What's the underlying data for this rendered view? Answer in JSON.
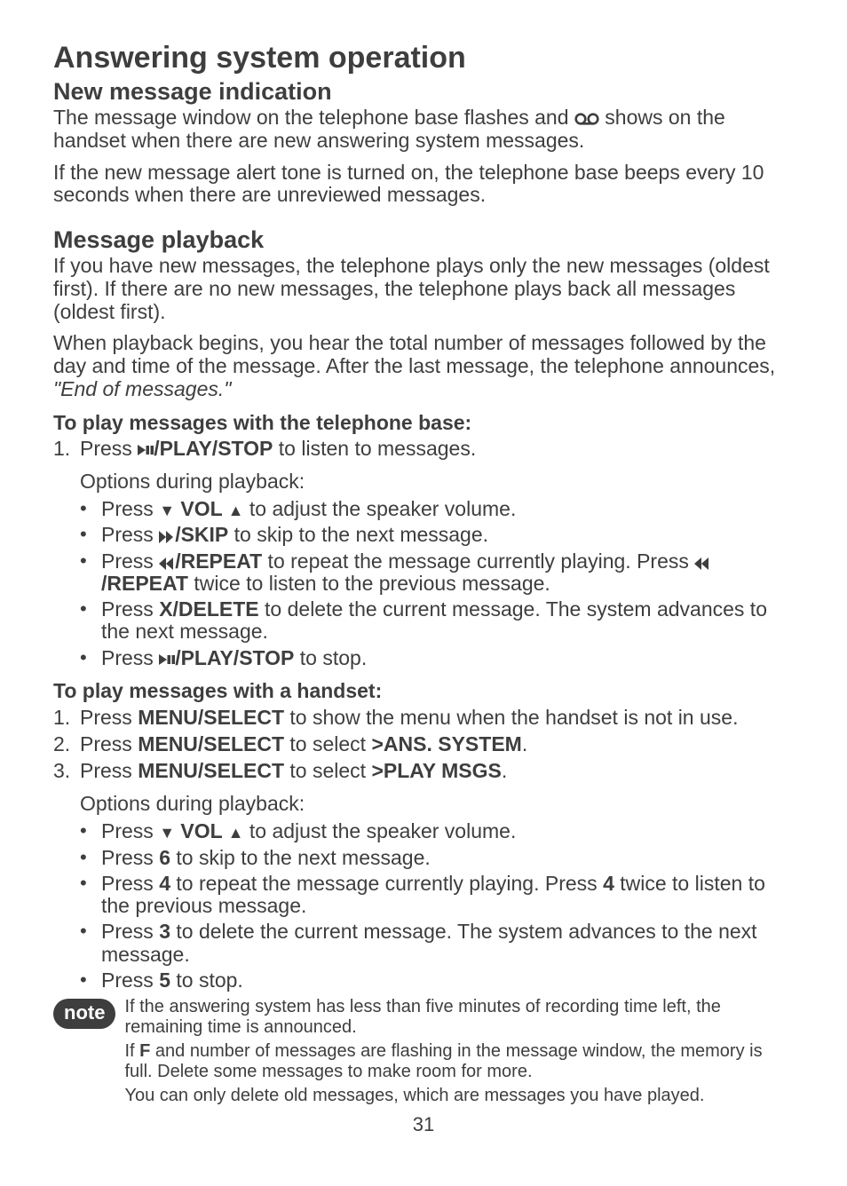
{
  "title": "Answering system operation",
  "sec1": {
    "heading": "New message indication",
    "p1_a": "The message window on the telephone base flashes and ",
    "p1_b": " shows on the handset when there are new answering system messages.",
    "p2": "If the new message alert tone is turned on, the telephone base beeps every 10 seconds when there are unreviewed messages."
  },
  "sec2": {
    "heading": "Message playback",
    "p1": "If you have new messages, the telephone plays only the new messages (oldest first). If there are no new messages, the telephone plays back all messages (oldest first).",
    "p2_a": "When playback begins, you hear the total number of messages followed by the day and time of the message.  After the last message, the telephone announces, ",
    "p2_italic": "\"End of messages.\""
  },
  "base": {
    "heading": "To play messages with the telephone base:",
    "step1_a": "Press ",
    "step1_b": "/PLAY/STOP",
    "step1_c": " to listen to messages.",
    "options_label": "Options during playback:",
    "b1_a": "Press ",
    "b1_vol": " VOL ",
    "b1_c": " to adjust the speaker volume.",
    "b2_a": "Press ",
    "b2_b": "/SKIP",
    "b2_c": " to skip to the next message.",
    "b3_a": "Press ",
    "b3_b": "/REPEAT",
    "b3_c": " to repeat the message currently playing. Press ",
    "b3_d": "/REPEAT",
    "b3_e": " twice to listen to the previous message.",
    "b4_a": "Press ",
    "b4_b": "X/DELETE",
    "b4_c": " to delete the current message. The system advances to the next message.",
    "b5_a": "Press  ",
    "b5_b": "/PLAY/STOP",
    "b5_c": " to stop."
  },
  "handset": {
    "heading": "To play messages with a handset:",
    "s1_a": "Press ",
    "s1_b": "MENU/SELECT",
    "s1_c": " to show the menu when the handset is not in use.",
    "s2_a": "Press ",
    "s2_b": "MENU/SELECT",
    "s2_c": " to select ",
    "s2_d": ">ANS. SYSTEM",
    "s2_e": ".",
    "s3_a": "Press ",
    "s3_b": "MENU/SELECT",
    "s3_c": " to select ",
    "s3_d": ">PLAY MSGS",
    "s3_e": ".",
    "options_label": "Options during playback:",
    "b1_a": "Press ",
    "b1_vol": " VOL ",
    "b1_c": " to adjust the speaker volume.",
    "b2_a": "Press ",
    "b2_b": "6",
    "b2_c": " to skip to the next message.",
    "b3_a": "Press ",
    "b3_b": "4",
    "b3_c": " to repeat the message currently playing. Press ",
    "b3_d": "4",
    "b3_e": " twice to listen to the previous message.",
    "b4_a": "Press ",
    "b4_b": "3",
    "b4_c": " to delete the current message. The system advances to the next message.",
    "b5_a": "Press ",
    "b5_b": "5",
    "b5_c": " to stop."
  },
  "note": {
    "badge": "note",
    "n1": "If the answering system has less than five minutes of recording time left, the remaining time is announced.",
    "n2_a": "If ",
    "n2_b": "F",
    "n2_c": " and number of messages are flashing in the message window, the memory is full. Delete some messages to make room for more.",
    "n3": "You can only delete old messages, which are messages you have played."
  },
  "page_number": "31"
}
